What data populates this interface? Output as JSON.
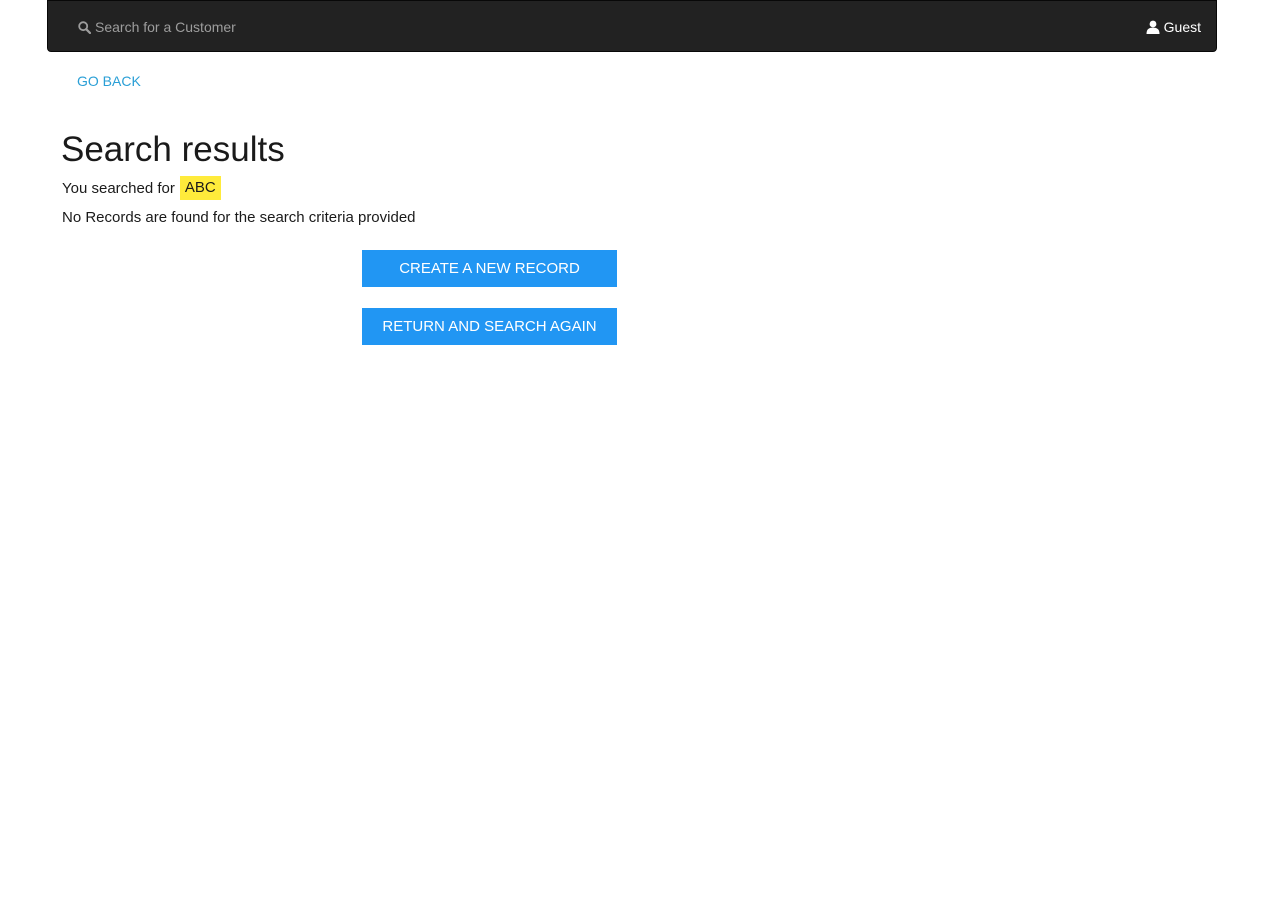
{
  "navbar": {
    "search_placeholder": "Search for a Customer",
    "search_icon": "search-icon",
    "user_icon": "user-icon",
    "user_name": "Guest",
    "background": "#222222"
  },
  "nav": {
    "go_back_label": "GO BACK"
  },
  "results": {
    "title": "Search results",
    "searched_prefix": "You searched for",
    "search_term": "ABC",
    "highlight_color": "#ffeb3b",
    "no_records_message": "No Records are found for the search criteria provided"
  },
  "actions": {
    "create_label": "CREATE A NEW RECORD",
    "return_label": "RETURN AND SEARCH AGAIN",
    "button_color": "#2196f3"
  },
  "colors": {
    "link": "#2a9fd6",
    "text": "#1a1a1a"
  }
}
